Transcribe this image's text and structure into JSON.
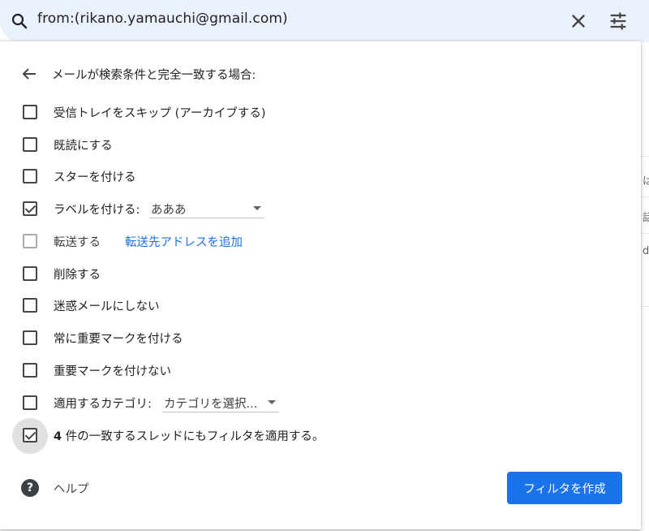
{
  "search": {
    "query": "from:(rikano.yamauchi@gmail.com)"
  },
  "panel": {
    "title": "メールが検索条件と完全一致する場合:",
    "options": [
      {
        "label": "受信トレイをスキップ (アーカイブする)",
        "checked": false
      },
      {
        "label": "既読にする",
        "checked": false
      },
      {
        "label": "スターを付ける",
        "checked": false
      },
      {
        "label": "ラベルを付ける:",
        "checked": true,
        "select_value": "あああ"
      },
      {
        "label": "転送する",
        "checked": false,
        "disabled": true,
        "link": "転送先アドレスを追加"
      },
      {
        "label": "削除する",
        "checked": false
      },
      {
        "label": "迷惑メールにしない",
        "checked": false
      },
      {
        "label": "常に重要マークを付ける",
        "checked": false
      },
      {
        "label": "重要マークを付けない",
        "checked": false
      },
      {
        "label": "適用するカテゴリ:",
        "checked": false,
        "select_value": "カテゴリを選択..."
      },
      {
        "count": "4",
        "label": " 件の一致するスレッドにもフィルタを適用する。",
        "checked": true
      }
    ],
    "help_label": "ヘルプ",
    "create_button": "フィルタを作成"
  },
  "background": {
    "partial_chars": [
      "は",
      "話",
      "d"
    ]
  },
  "colors": {
    "search_bg": "#eaf1fb",
    "primary": "#1a73e8",
    "link": "#1a73e8"
  }
}
